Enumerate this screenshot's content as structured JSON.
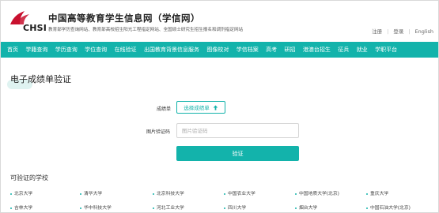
{
  "header": {
    "logo_text": "CHSI",
    "site_title": "中国高等教育学生信息网（学信网）",
    "site_subtitle": "教育部学历查询网站、教育部高校招生阳光工程指定网站、全国硕士研究生招生报名和调剂指定网站",
    "links": [
      "注册",
      "登录",
      "English"
    ]
  },
  "nav": {
    "items": [
      "首页",
      "学籍查询",
      "学历查询",
      "学位查询",
      "在线验证",
      "出国教育背景信息服务",
      "图像校对",
      "学信档案",
      "高考",
      "研招",
      "港澳台招生",
      "征兵",
      "就业",
      "学职平台"
    ]
  },
  "main": {
    "page_title": "电子成绩单验证",
    "transcript_label": "成绩单",
    "select_button_label": "选择成绩单",
    "captcha_label": "图片验证码",
    "captcha_placeholder": "图片验证码",
    "captcha_value": "",
    "submit_label": "验证"
  },
  "schools": {
    "title": "可验证的学校",
    "rows": [
      [
        "北京大学",
        "清华大学",
        "北京科技大学",
        "中国农业大学",
        "中国地质大学(北京)",
        "重庆大学"
      ],
      [
        "吉林大学",
        "华中科技大学",
        "河北工业大学",
        "四川大学",
        "烟台大学",
        "中国石油大学(北京)"
      ]
    ]
  },
  "colors": {
    "accent": "#13b3ab",
    "logo_red": "#c8102e"
  }
}
